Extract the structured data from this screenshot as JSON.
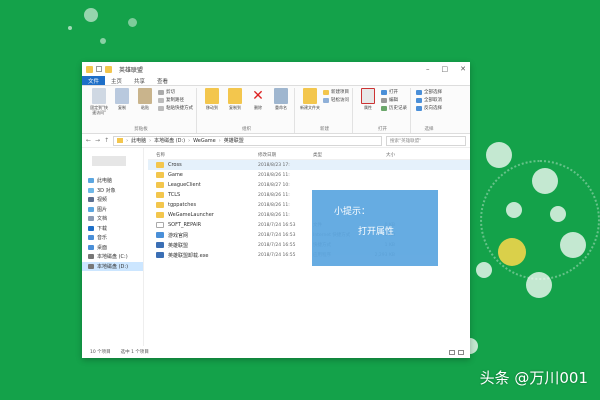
{
  "window": {
    "title": "英雄联盟"
  },
  "ribbon_tabs": [
    "文件",
    "主页",
    "共享",
    "查看"
  ],
  "ribbon": {
    "clipboard": {
      "label": "剪贴板",
      "pin": "固定到\"快速访问\"",
      "copy": "复制",
      "paste": "粘贴",
      "cut": "剪切",
      "copy_path": "复制路径",
      "paste_shortcut": "粘贴快捷方式"
    },
    "organize": {
      "label": "组织",
      "move_to": "移动到",
      "copy_to": "复制到",
      "delete": "删除",
      "rename": "重命名"
    },
    "new": {
      "label": "新建",
      "new_folder": "新建文件夹",
      "new_item": "新建项目",
      "easy_access": "轻松访问"
    },
    "open": {
      "label": "打开",
      "properties": "属性",
      "open": "打开",
      "edit": "编辑",
      "history": "历史记录"
    },
    "select": {
      "label": "选择",
      "select_all": "全部选择",
      "select_none": "全部取消",
      "invert": "反向选择"
    }
  },
  "address": {
    "segments": [
      "此电脑",
      "本地磁盘 (D:)",
      "WeGame",
      "英雄联盟"
    ],
    "search_placeholder": "搜索\"英雄联盟\""
  },
  "sidebar": {
    "items": [
      {
        "label": "此电脑",
        "icon": "computer-icon",
        "color": "#5ba6e0"
      },
      {
        "label": "3D 对象",
        "icon": "cube-icon",
        "color": "#6fb8e8"
      },
      {
        "label": "视频",
        "icon": "video-icon",
        "color": "#5c6f8f"
      },
      {
        "label": "图片",
        "icon": "picture-icon",
        "color": "#5ba6e0"
      },
      {
        "label": "文档",
        "icon": "document-icon",
        "color": "#8a9bb3"
      },
      {
        "label": "下载",
        "icon": "download-icon",
        "color": "#1e6fc8"
      },
      {
        "label": "音乐",
        "icon": "music-icon",
        "color": "#4a8fd8"
      },
      {
        "label": "桌面",
        "icon": "desktop-icon",
        "color": "#4a8fd8"
      },
      {
        "label": "本地磁盘 (C:)",
        "icon": "drive-icon",
        "color": "#777777"
      },
      {
        "label": "本地磁盘 (D:)",
        "icon": "drive-icon",
        "color": "#777777"
      }
    ]
  },
  "columns": [
    "名称",
    "修改日期",
    "类型",
    "大小"
  ],
  "files": [
    {
      "name": "Cross",
      "date": "2018/8/23 17:",
      "type": "",
      "size": "",
      "icon": "folder-icon",
      "color": "#f3c64d"
    },
    {
      "name": "Game",
      "date": "2018/8/26 11:",
      "type": "",
      "size": "",
      "icon": "folder-icon",
      "color": "#f3c64d"
    },
    {
      "name": "LeagueClient",
      "date": "2018/8/27 10:",
      "type": "",
      "size": "",
      "icon": "folder-icon",
      "color": "#f3c64d"
    },
    {
      "name": "TCLS",
      "date": "2018/8/26 11:",
      "type": "",
      "size": "",
      "icon": "folder-icon",
      "color": "#f3c64d"
    },
    {
      "name": "tgppatches",
      "date": "2018/8/26 11:",
      "type": "",
      "size": "",
      "icon": "folder-icon",
      "color": "#f3c64d"
    },
    {
      "name": "WeGameLauncher",
      "date": "2018/8/26 11:",
      "type": "",
      "size": "",
      "icon": "folder-icon",
      "color": "#f3c64d"
    },
    {
      "name": "SOFT_REPAIR",
      "date": "2018/7/24 16:53",
      "type": "文件",
      "size": "0 KB",
      "icon": "file-icon",
      "color": "#ffffff"
    },
    {
      "name": "游戏官网",
      "date": "2018/7/24 16:53",
      "type": "Internet 快捷方式",
      "size": "1 KB",
      "icon": "shortcut-icon",
      "color": "#4a8fd8"
    },
    {
      "name": "英雄联盟",
      "date": "2018/7/24 16:55",
      "type": "快捷方式",
      "size": "1 KB",
      "icon": "shortcut-icon",
      "color": "#3b6fb5"
    },
    {
      "name": "英雄联盟卸载.exe",
      "date": "2018/7/24 16:55",
      "type": "应用程序",
      "size": "2,293 KB",
      "icon": "exe-icon",
      "color": "#3b6fb5"
    }
  ],
  "tip": {
    "line1": "小提示：",
    "line2": "打开属性"
  },
  "status": {
    "count": "10 个项目",
    "selected": "选中 1 个项目"
  },
  "watermark": "头条 @万川001",
  "colors": {
    "background": "#14a24a",
    "accent": "#1e6fc8",
    "tip": "#5ba6e0",
    "folder": "#f3c64d"
  }
}
